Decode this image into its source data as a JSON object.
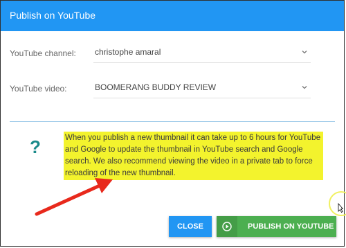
{
  "dialog": {
    "title": "Publish on YouTube"
  },
  "fields": {
    "channel": {
      "label": "YouTube channel:",
      "value": "christophe amaral"
    },
    "video": {
      "label": "YouTube video:",
      "value": "BOOMERANG BUDDY REVIEW"
    }
  },
  "notice": {
    "icon": "question-mark-icon",
    "text": "When you publish a new thumbnail it can take up to 6 hours for YouTube and Google to update the thumbnail in YouTube search and Google search. We also recommend viewing the video in a private tab to force reloading of the new thumbnail."
  },
  "buttons": {
    "close": "CLOSE",
    "publish": "PUBLISH ON YOUTUBE",
    "publish_icon": "play-circle-icon"
  },
  "colors": {
    "titlebar": "#2196f3",
    "close_button": "#2196f3",
    "publish_button": "#4caf50",
    "highlight": "#f3f32d",
    "annotation_arrow": "#e8291c"
  }
}
